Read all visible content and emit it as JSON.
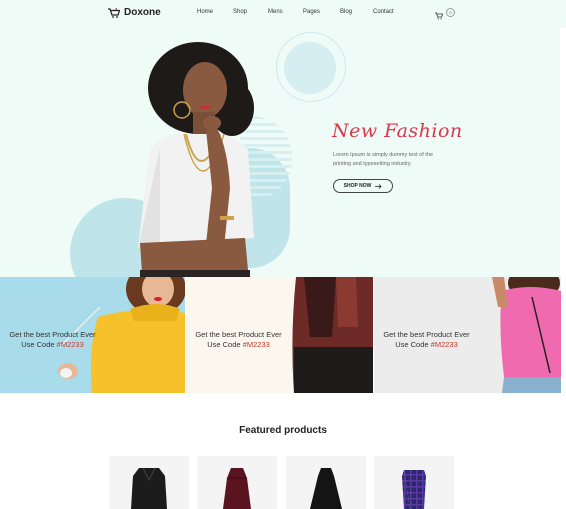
{
  "brand": {
    "name": "Doxone"
  },
  "nav": {
    "items": [
      {
        "label": "Home"
      },
      {
        "label": "Shop"
      },
      {
        "label": "Mens"
      },
      {
        "label": "Pages"
      },
      {
        "label": "Blog"
      },
      {
        "label": "Contact"
      }
    ]
  },
  "cart": {
    "count": "0"
  },
  "hero": {
    "title": "New Fashion",
    "text": "Lorem Ipsum is simply dummy text of the printing and typesetting industry.",
    "button_label": "SHOP NOW"
  },
  "promos": [
    {
      "line1": "Get the best Product Ever",
      "line2_prefix": "Use Code ",
      "code": "#M2233"
    },
    {
      "line1": "Get the best Product Ever",
      "line2_prefix": "Use Code ",
      "code": "#M2233"
    },
    {
      "line1": "Get the best Product Ever",
      "line2_prefix": "Use Code ",
      "code": "#M2233"
    }
  ],
  "featured": {
    "title": "Featured products"
  },
  "colors": {
    "accent": "#d9384a",
    "hero_bg": "#effbf7",
    "promo_code": "#c0392b"
  }
}
